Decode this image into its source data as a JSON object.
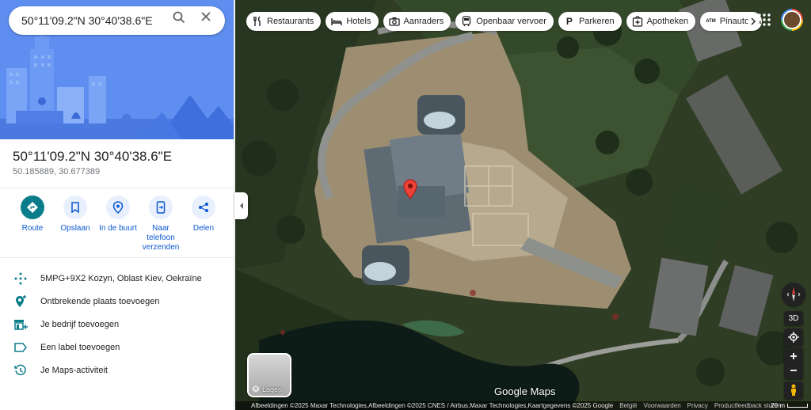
{
  "search": {
    "value": "50°11'09.2\"N 30°40'38.6\"E"
  },
  "place": {
    "title": "50°11'09.2\"N 30°40'38.6\"E",
    "decimal": "50.185889, 30.677389"
  },
  "actions": [
    {
      "label": "Route",
      "icon": "directions-icon"
    },
    {
      "label": "Opslaan",
      "icon": "bookmark-icon"
    },
    {
      "label": "In de buurt",
      "icon": "nearby-icon"
    },
    {
      "label": "Naar telefoon verzenden",
      "icon": "send-to-phone-icon"
    },
    {
      "label": "Delen",
      "icon": "share-icon"
    }
  ],
  "details": [
    {
      "text": "5MPG+9X2 Kozyn, Oblast Kiev, Oekraïne",
      "icon": "plus-code-icon"
    },
    {
      "text": "Ontbrekende plaats toevoegen",
      "icon": "add-place-icon"
    },
    {
      "text": "Je bedrijf toevoegen",
      "icon": "add-business-icon"
    },
    {
      "text": "Een label toevoegen",
      "icon": "label-icon"
    },
    {
      "text": "Je Maps-activiteit",
      "icon": "history-icon"
    }
  ],
  "chips": [
    {
      "label": "Restaurants",
      "icon": "restaurant-icon"
    },
    {
      "label": "Hotels",
      "icon": "hotel-icon"
    },
    {
      "label": "Aanraders",
      "icon": "camera-icon"
    },
    {
      "label": "Openbaar vervoer",
      "icon": "transit-icon"
    },
    {
      "label": "Parkeren",
      "icon": "parking-icon"
    },
    {
      "label": "Apotheken",
      "icon": "pharmacy-icon"
    },
    {
      "label": "Pinautomaten",
      "icon": "atm-icon"
    }
  ],
  "atm_icon_text": "ATM",
  "parking_icon_text": "P",
  "layers_label": "Lagen",
  "brand": "Google Maps",
  "footer": {
    "credits": "Afbeeldingen ©2025 Maxar Technologies,Afbeeldingen ©2025 CNES / Airbus,Maxar Technologies,Kaartgegevens ©2025 Google",
    "links": [
      "België",
      "Voorwaarden",
      "Privacy",
      "Productfeedback sturen"
    ],
    "scale": "20 m"
  },
  "controls": {
    "tilt_label": "3D"
  },
  "colors": {
    "accent": "#0b7d8a",
    "link": "#0b57d0",
    "pin": "#ea4335",
    "hero": "#5f8ff0"
  }
}
